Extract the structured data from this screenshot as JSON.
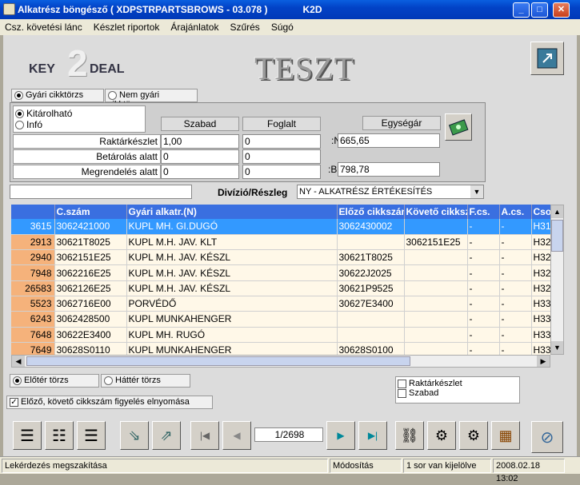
{
  "window": {
    "title": "Alkatrész böngésző ( XDPSTRPARTSBROWS - 03.078 )",
    "app": "K2D"
  },
  "menu": [
    "Csz. követési lánc",
    "Készlet riportok",
    "Árajánlatok",
    "Szűrés",
    "Súgó"
  ],
  "brand": {
    "logo_text_left": "KEY",
    "logo_digit": "2",
    "logo_text_right": "DEAL",
    "env": "TESZT"
  },
  "tabs": {
    "gyari": "Gyári cikktörzs",
    "nemgyari": "Nem gyári cikktörzs"
  },
  "mode": {
    "kitarolhato": "Kitárolható",
    "info": "Infó"
  },
  "stock": {
    "hdr_szabad": "Szabad",
    "hdr_foglalt": "Foglalt",
    "raktar_label": "Raktárkészlet",
    "raktar_szabad": "1,00",
    "raktar_foglalt": "0",
    "betarolas_label": "Betárolás alatt",
    "betarolas_szabad": "0",
    "betarolas_foglalt": "0",
    "megrendeles_label": "Megrendelés alatt",
    "megrendeles_szabad": "0",
    "megrendeles_foglalt": "0"
  },
  "price": {
    "hdr": "Egységár",
    "netto_label": ":Nettó",
    "netto": "665,65",
    "brutto_label": ":Bruttó",
    "brutto": "798,78"
  },
  "division": {
    "label": "Divízió/Részleg",
    "value": "NY - ALKATRÉSZ ÉRTÉKESÍTÉS"
  },
  "grid": {
    "columns": [
      "",
      "C.szám",
      "Gyári alkatr.(N)",
      "Előző cikkszám",
      "Követő cikkszám",
      "F.cs.",
      "A.cs.",
      "Csop"
    ],
    "rows": [
      [
        "3615",
        "3062421000",
        "KUPL MH. GI.DUGÓ",
        "3062430002",
        "",
        "-",
        "-",
        "H31"
      ],
      [
        "2913",
        "30621T8025",
        "KUPL M.H. JAV. KLT",
        "",
        "3062151E25",
        "-",
        "-",
        "H32"
      ],
      [
        "2940",
        "3062151E25",
        "KUPL M.H. JAV. KÉSZL",
        "30621T8025",
        "",
        "-",
        "-",
        "H32"
      ],
      [
        "7948",
        "3062216E25",
        "KUPL M.H. JAV. KÉSZL",
        "30622J2025",
        "",
        "-",
        "-",
        "H32"
      ],
      [
        "26583",
        "3062126E25",
        "KUPL M.H. JAV. KÉSZL",
        "30621P9525",
        "",
        "-",
        "-",
        "H32"
      ],
      [
        "5523",
        "3062716E00",
        "PORVÉDŐ",
        "30627E3400",
        "",
        "-",
        "-",
        "H33"
      ],
      [
        "6243",
        "3062428500",
        "KUPL MUNKAHENGER",
        "",
        "",
        "-",
        "-",
        "H33"
      ],
      [
        "7648",
        "30622E3400",
        "KUPL MH. RUGÓ",
        "",
        "",
        "-",
        "-",
        "H33"
      ],
      [
        "7649",
        "30628S0110",
        "KUPL MUNKAHENGER",
        "30628S0100",
        "",
        "-",
        "-",
        "H33"
      ]
    ]
  },
  "bottom": {
    "eloter": "Előtér törzs",
    "hatter": "Háttér törzs",
    "raktarkeszlet": "Raktárkészlet",
    "szabad": "Szabad",
    "elnyomas": "Előző, követő cikkszám figyelés elnyomása"
  },
  "nav": {
    "position": "1/2698"
  },
  "status": {
    "s1": "Lekérdezés megszakítása",
    "s2": "Módosítás",
    "s3": "1 sor van kijelölve",
    "s4": "2008.02.18 13:02"
  }
}
